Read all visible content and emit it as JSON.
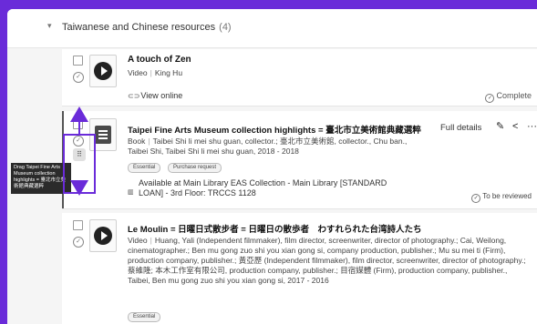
{
  "section": {
    "title": "Taiwanese and Chinese resources",
    "count": "(4)"
  },
  "items": [
    {
      "title": "A touch of Zen",
      "type": "Video",
      "creator": "King Hu",
      "link_label": "View online",
      "status": "Complete"
    },
    {
      "title": "Taipei Fine Arts Museum collection highlights = 臺北市立美術館典藏選粹",
      "type": "Book",
      "meta_line1": "Taibei Shi li mei shu guan, collector.; 臺北市立美術館, collector., Chu ban.,",
      "meta_line2": "Taibei Shi, Taibei Shi li mei shu guan, 2018 - 2018",
      "tags": [
        "Essential",
        "Purchase request"
      ],
      "availability_line1": "Available at Main Library EAS Collection - Main Library [STANDARD",
      "availability_line2": "LOAN] - 3rd Floor: TRCCS 1128",
      "status": "To be reviewed",
      "full_details_label": "Full details",
      "tooltip": "Drag Taipei Fine Arts Museum collection highlights = 臺北市立美術館典藏選粹"
    },
    {
      "title": "Le Moulin = 日曜日式散步者 = 日曜日の散歩者　わすれられた台湾詩人たち",
      "type": "Video",
      "meta": "Huang, Yali (Independent filmmaker), film director, screenwriter, director of photography.; Cai, Weilong, cinematographer.; Ben mu gong zuo shi you xian gong si, company production, publisher.; Mu su mei ti (Firm), production company, publisher.; 黃亞歷 (Independent filmmaker), film director, screenwriter, director of photography.; 蔡維隆; 本木工作室有限公司, production company, publisher.; 目宿媒體 (Firm), production company, publisher., Taibei, Ben mu gong zuo shi you xian gong si, 2017 - 2016",
      "tags": [
        "Essential"
      ]
    }
  ],
  "icons": {
    "chevron": "chevron-down-icon",
    "play": "play-icon",
    "book": "book-icon",
    "link": "link-icon",
    "check": "check-circle-icon",
    "edit": "pencil-icon",
    "share": "share-icon",
    "more": "more-icon",
    "drag": "drag-handle-icon"
  },
  "colors": {
    "background_accent": "#6a2bd9",
    "annotation": "#6a2bd9"
  }
}
